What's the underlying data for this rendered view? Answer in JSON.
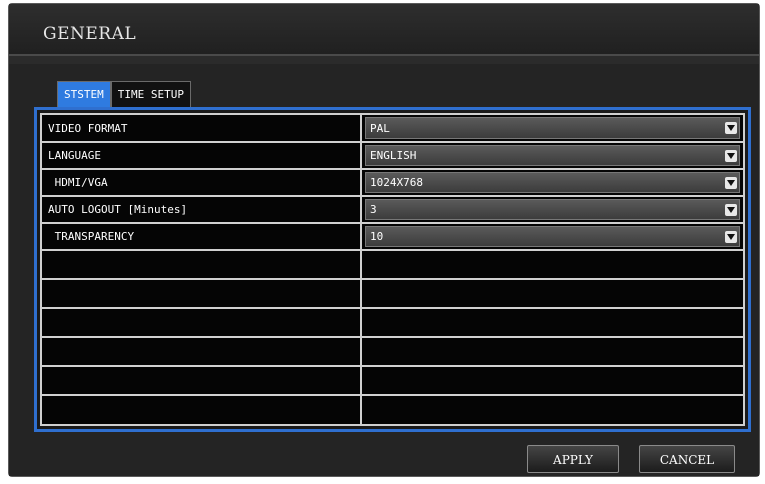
{
  "window": {
    "title": "GENERAL"
  },
  "tabs": [
    {
      "label": "STSTEM",
      "active": true
    },
    {
      "label": "TIME SETUP",
      "active": false
    }
  ],
  "settings": [
    {
      "label": "VIDEO FORMAT",
      "value": "PAL"
    },
    {
      "label": "LANGUAGE",
      "value": "ENGLISH"
    },
    {
      "label": " HDMI/VGA",
      "value": "1024X768"
    },
    {
      "label": "AUTO LOGOUT [Minutes]",
      "value": "3"
    },
    {
      "label": " TRANSPARENCY",
      "value": "10"
    }
  ],
  "buttons": {
    "apply": "APPLY",
    "cancel": "CANCEL"
  },
  "colors": {
    "accent": "#2f7be0",
    "panel_border": "#2f6fcf",
    "background": "#2b2b2b"
  }
}
